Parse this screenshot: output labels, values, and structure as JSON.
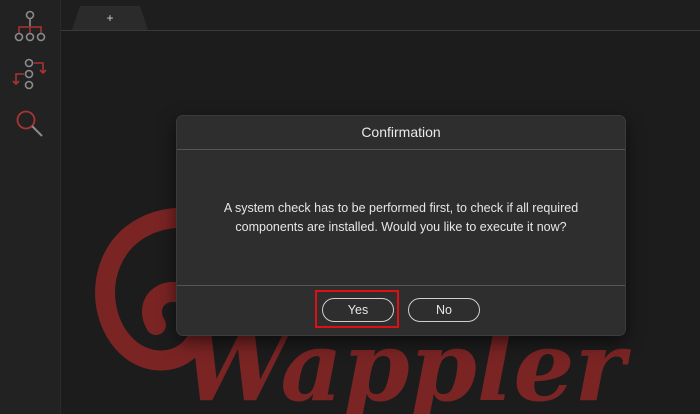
{
  "tabs": {
    "new_tab_label": "+"
  },
  "sidebar": {
    "items": [
      {
        "icon": "hierarchy-icon"
      },
      {
        "icon": "workflow-icon"
      },
      {
        "icon": "search-icon"
      }
    ]
  },
  "dialog": {
    "title": "Confirmation",
    "message": "A system check has to be performed first, to check if all required components are installed. Would you like to execute it now?",
    "yes_label": "Yes",
    "no_label": "No"
  },
  "watermark": {
    "text": "Wappler"
  },
  "colors": {
    "accent": "#8b2626",
    "highlight": "#dd1111",
    "background": "#1c1c1c",
    "dialog": "#2e2e2e"
  }
}
